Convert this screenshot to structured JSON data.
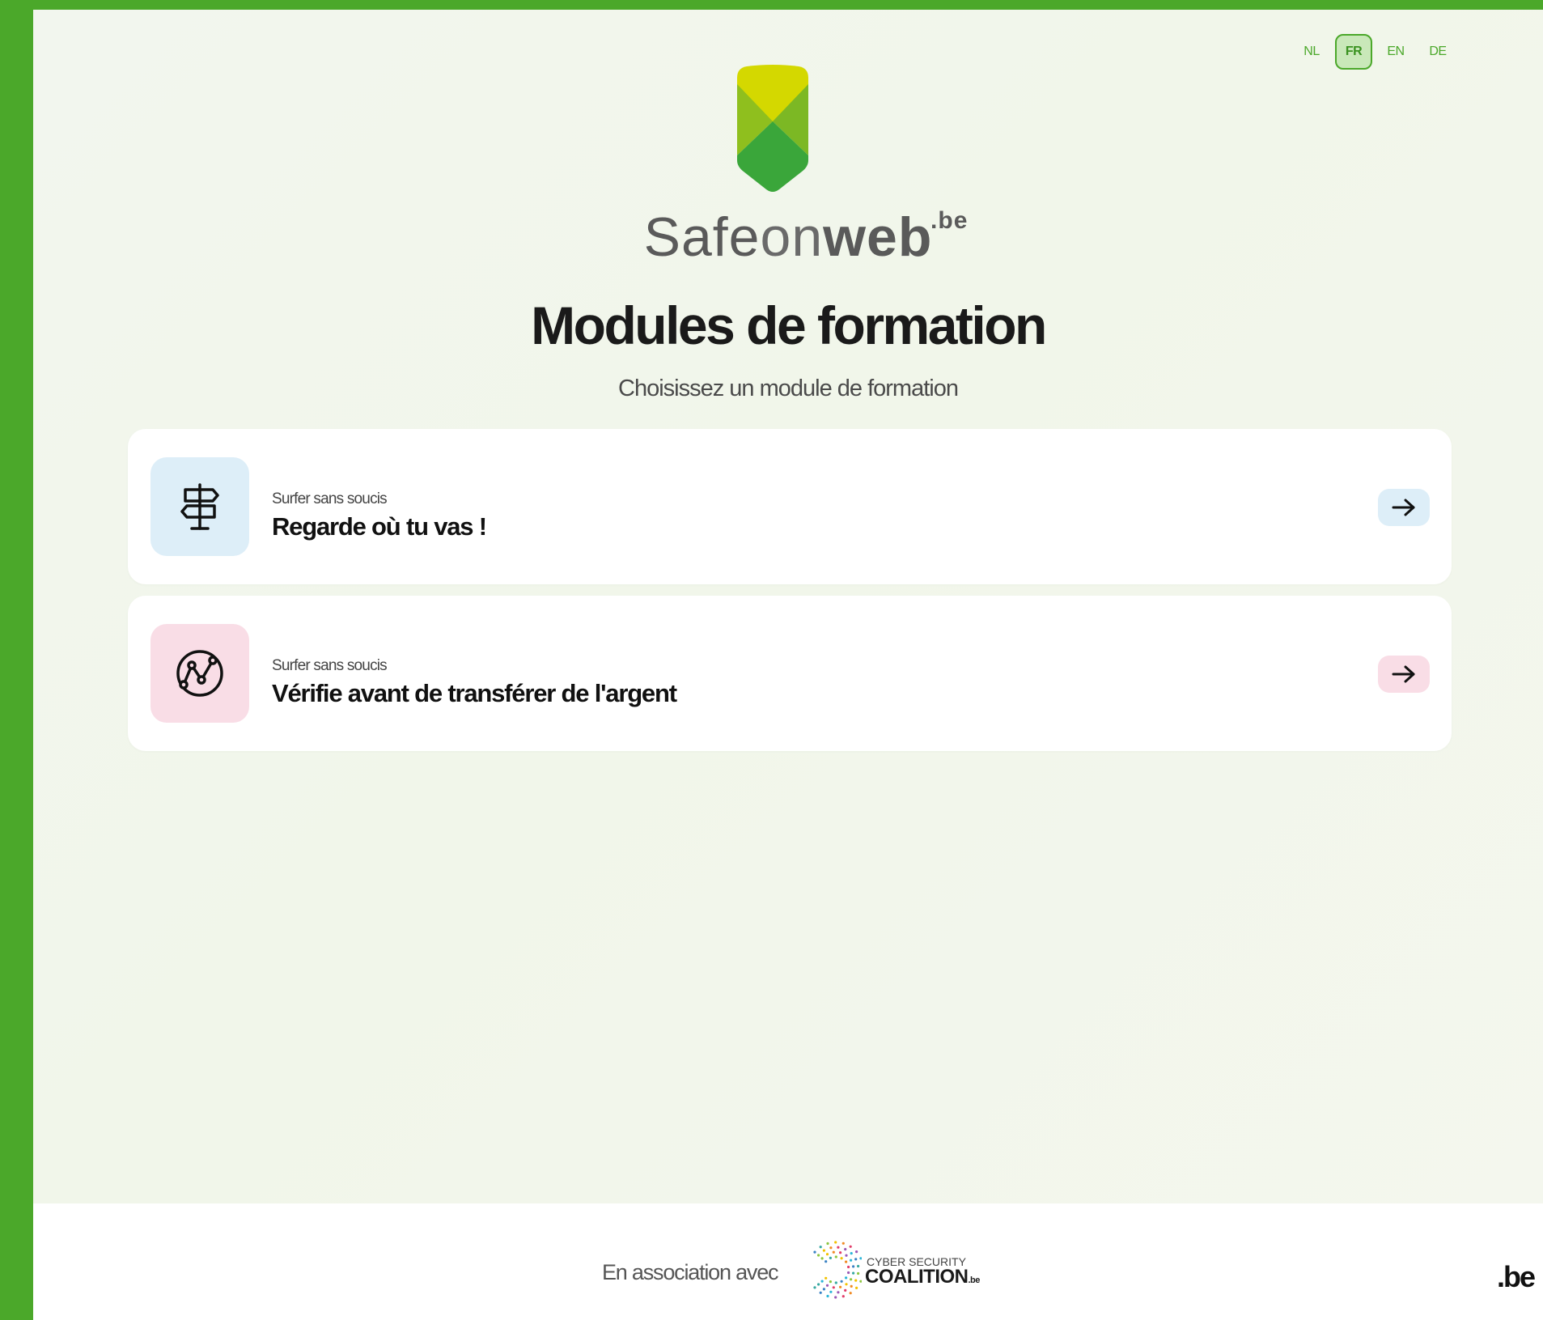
{
  "languages": {
    "nl": "NL",
    "fr": "FR",
    "en": "EN",
    "de": "DE",
    "selected": "FR"
  },
  "brand": {
    "safe": "Safe",
    "on": "on",
    "web": "web",
    "tld": ".be"
  },
  "header": {
    "title": "Modules de formation",
    "subtitle": "Choisissez un module de formation"
  },
  "modules": [
    {
      "category": "Surfer sans soucis",
      "title": "Regarde où tu vas !",
      "icon": "signpost-icon",
      "accent": "#ddeef8"
    },
    {
      "category": "Surfer sans soucis",
      "title": "Vérifie avant de transférer de l'argent",
      "icon": "money-transfer-icon",
      "accent": "#f9dde6"
    }
  ],
  "footer": {
    "association_text": "En association avec",
    "partner_small": "CYBER SECURITY",
    "partner_big": "COALITION",
    "partner_suffix": ".be",
    "gov_logo": ".be"
  },
  "colors": {
    "brand_green": "#4ba82a",
    "logo_yellow": "#d4d800",
    "logo_green": "#3aa63a",
    "logo_mid": "#8fbf1e"
  }
}
